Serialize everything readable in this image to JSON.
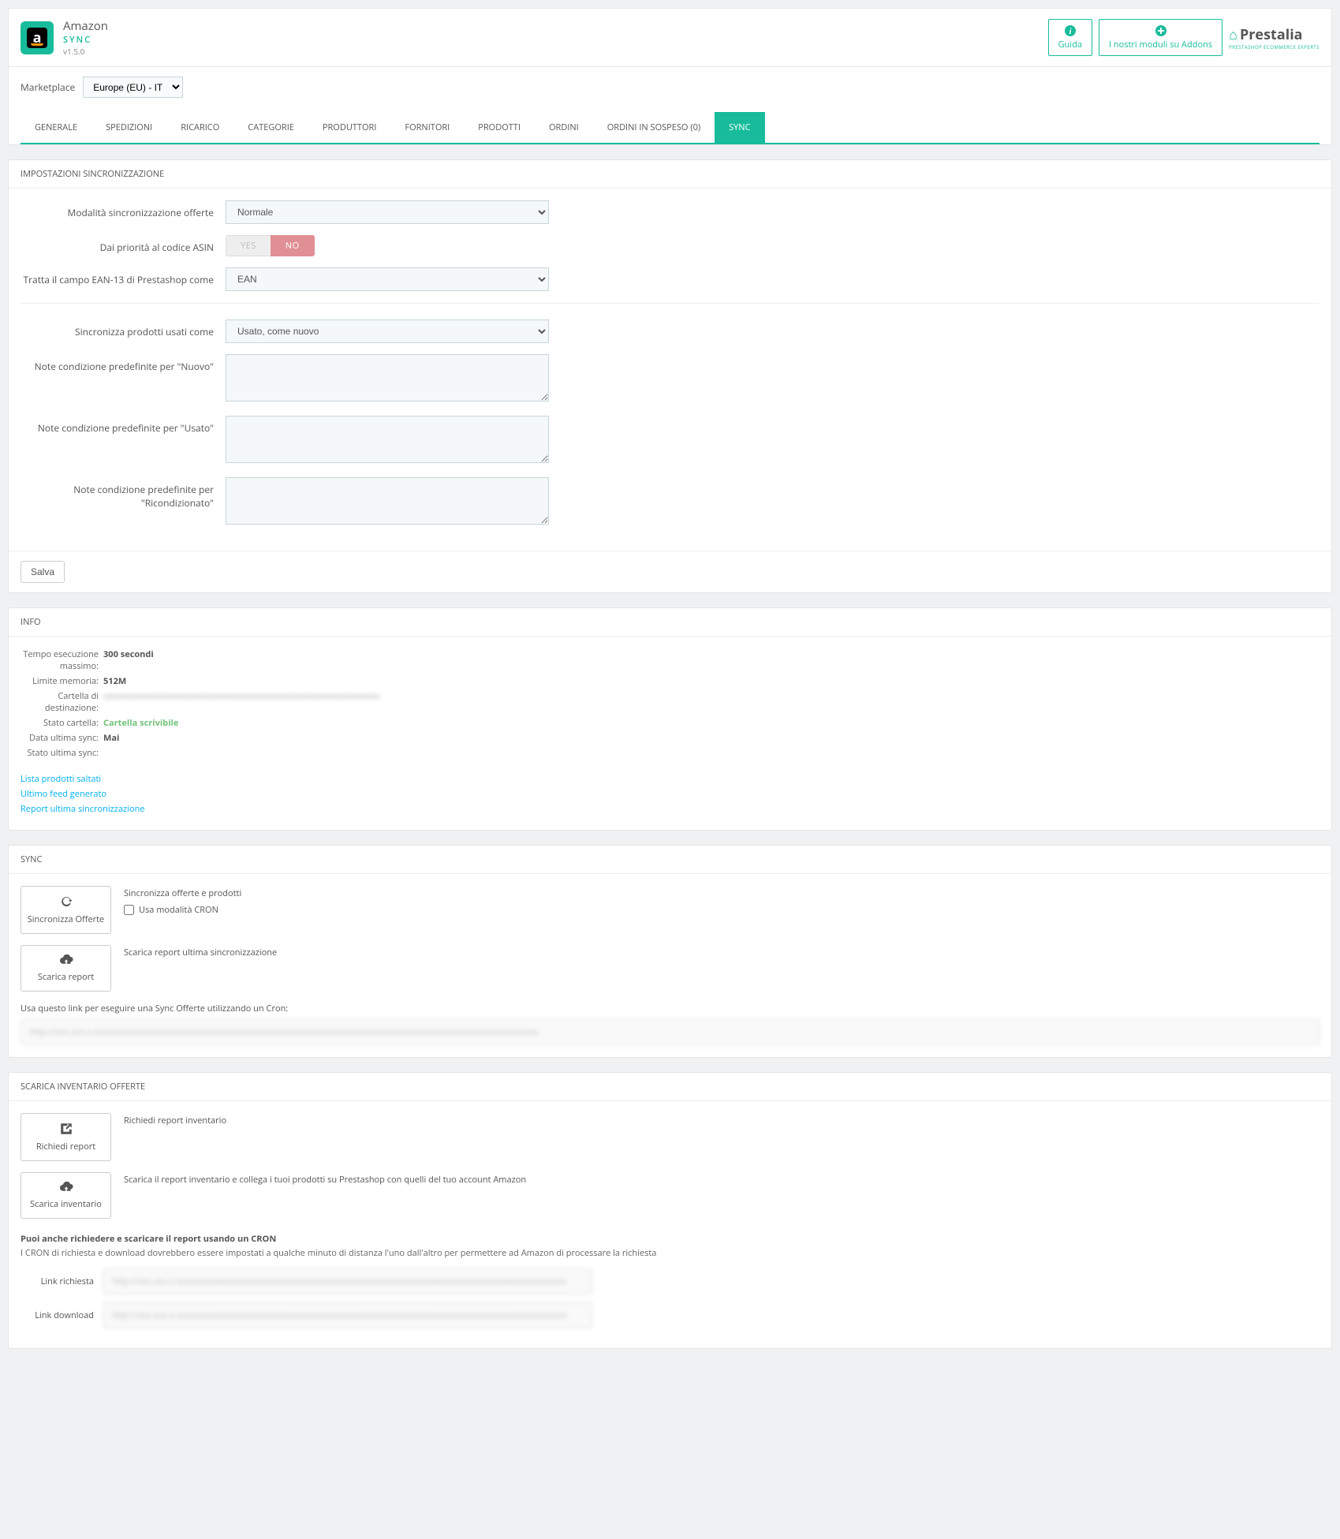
{
  "header": {
    "title": "Amazon",
    "sub": "SYNC",
    "version": "v1.5.0",
    "guide": "Guida",
    "addons": "I nostri moduli su Addons",
    "brand": "Prestalia",
    "brand_sub": "PRESTASHOP ECOMMERCE EXPERTS"
  },
  "mp": {
    "label": "Marketplace",
    "value": "Europe (EU) - IT"
  },
  "tabs": [
    "GENERALE",
    "SPEDIZIONI",
    "RICARICO",
    "CATEGORIE",
    "PRODUTTORI",
    "FORNITORI",
    "PRODOTTI",
    "ORDINI",
    "ORDINI IN SOSPESO (0)",
    "SYNC"
  ],
  "active_tab": 9,
  "panel1": {
    "title": "IMPOSTAZIONI SINCRONIZZAZIONE",
    "mode_label": "Modalità sincronizzazione offerte",
    "mode_value": "Normale",
    "asin_label": "Dai priorità al codice ASIN",
    "yes": "YES",
    "no": "NO",
    "ean_label": "Tratta il campo EAN-13 di Prestashop come",
    "ean_value": "EAN",
    "used_label": "Sincronizza prodotti usati come",
    "used_value": "Usato, come nuovo",
    "note_new": "Note condizione predefinite per \"Nuovo\"",
    "note_used": "Note condizione predefinite per \"Usato\"",
    "note_refurb": "Note condizione predefinite per \"Ricondizionato\"",
    "save": "Salva"
  },
  "info": {
    "title": "INFO",
    "rows": {
      "exec_l": "Tempo esecuzione massimo:",
      "exec_v": "300 secondi",
      "mem_l": "Limite memoria:",
      "mem_v": "512M",
      "folder_l": "Cartella di destinazione:",
      "folder_v": "xxxxxxxxxxxxxxxxxxxxxxxxxxxxxxxxxxxxxxxxxxxxxxxxxxxxxxxx",
      "fstate_l": "Stato cartella:",
      "fstate_v": "Cartella scrivibile",
      "lsync_l": "Data ultima sync:",
      "lsync_v": "Mai",
      "sstate_l": "Stato ultima sync:",
      "sstate_v": ""
    },
    "links": [
      "Lista prodotti saltati",
      "Ultimo feed generato",
      "Report ultima sincronizzazione"
    ]
  },
  "sync": {
    "title": "SYNC",
    "btn1": "Sincronizza Offerte",
    "desc1": "Sincronizza offerte e prodotti",
    "chk1": "Usa modalità CRON",
    "btn2": "Scarica report",
    "desc2": "Scarica report ultima sincronizzazione",
    "cron_hint": "Usa questo link per eseguire una Sync Offerte utilizzando un Cron:",
    "cron_url": "http://xxx.xxx.x.xxxxxxxxxxxxxxxxxxxxxxxxxxxxxxxxxxxxxxxxxxxxxxxxxxxxxxxxxxxxxxxxxxxxxxxxxxxxxxxxxxxxxxxxxxxxxxxxxx"
  },
  "inv": {
    "title": "SCARICA INVENTARIO OFFERTE",
    "btn1": "Richiedi report",
    "desc1": "Richiedi report inventario",
    "btn2": "Scarica inventario",
    "desc2": "Scarica il report inventario e collega i tuoi prodotti su Prestashop con quelli del tuo account Amazon",
    "cron_t": "Puoi anche richiedere e scaricare il report usando un CRON",
    "cron_s": "I CRON di richiesta e download dovrebbero essere impostati a qualche minuto di distanza l'uno dall'altro per permettere ad Amazon di processare la richiesta",
    "l1_l": "Link richiesta",
    "l1_v": "http://xxx.xxx.x.xxxxxxxxxxxxxxxxxxxxxxxxxxxxxxxxxxxxxxxxxxxxxxxxxxxxxxxxxxxxxxxxxxxxxxxxxxxxxxxxxxxxxx",
    "l2_l": "Link download",
    "l2_v": "http://xxx.xxx.x.xxxxxxxxxxxxxxxxxxxxxxxxxxxxxxxxxxxxxxxxxxxxxxxxxxxxxxxxxxxxxxxxxxxxxxxxxxxxxxxxxxxxxx"
  }
}
